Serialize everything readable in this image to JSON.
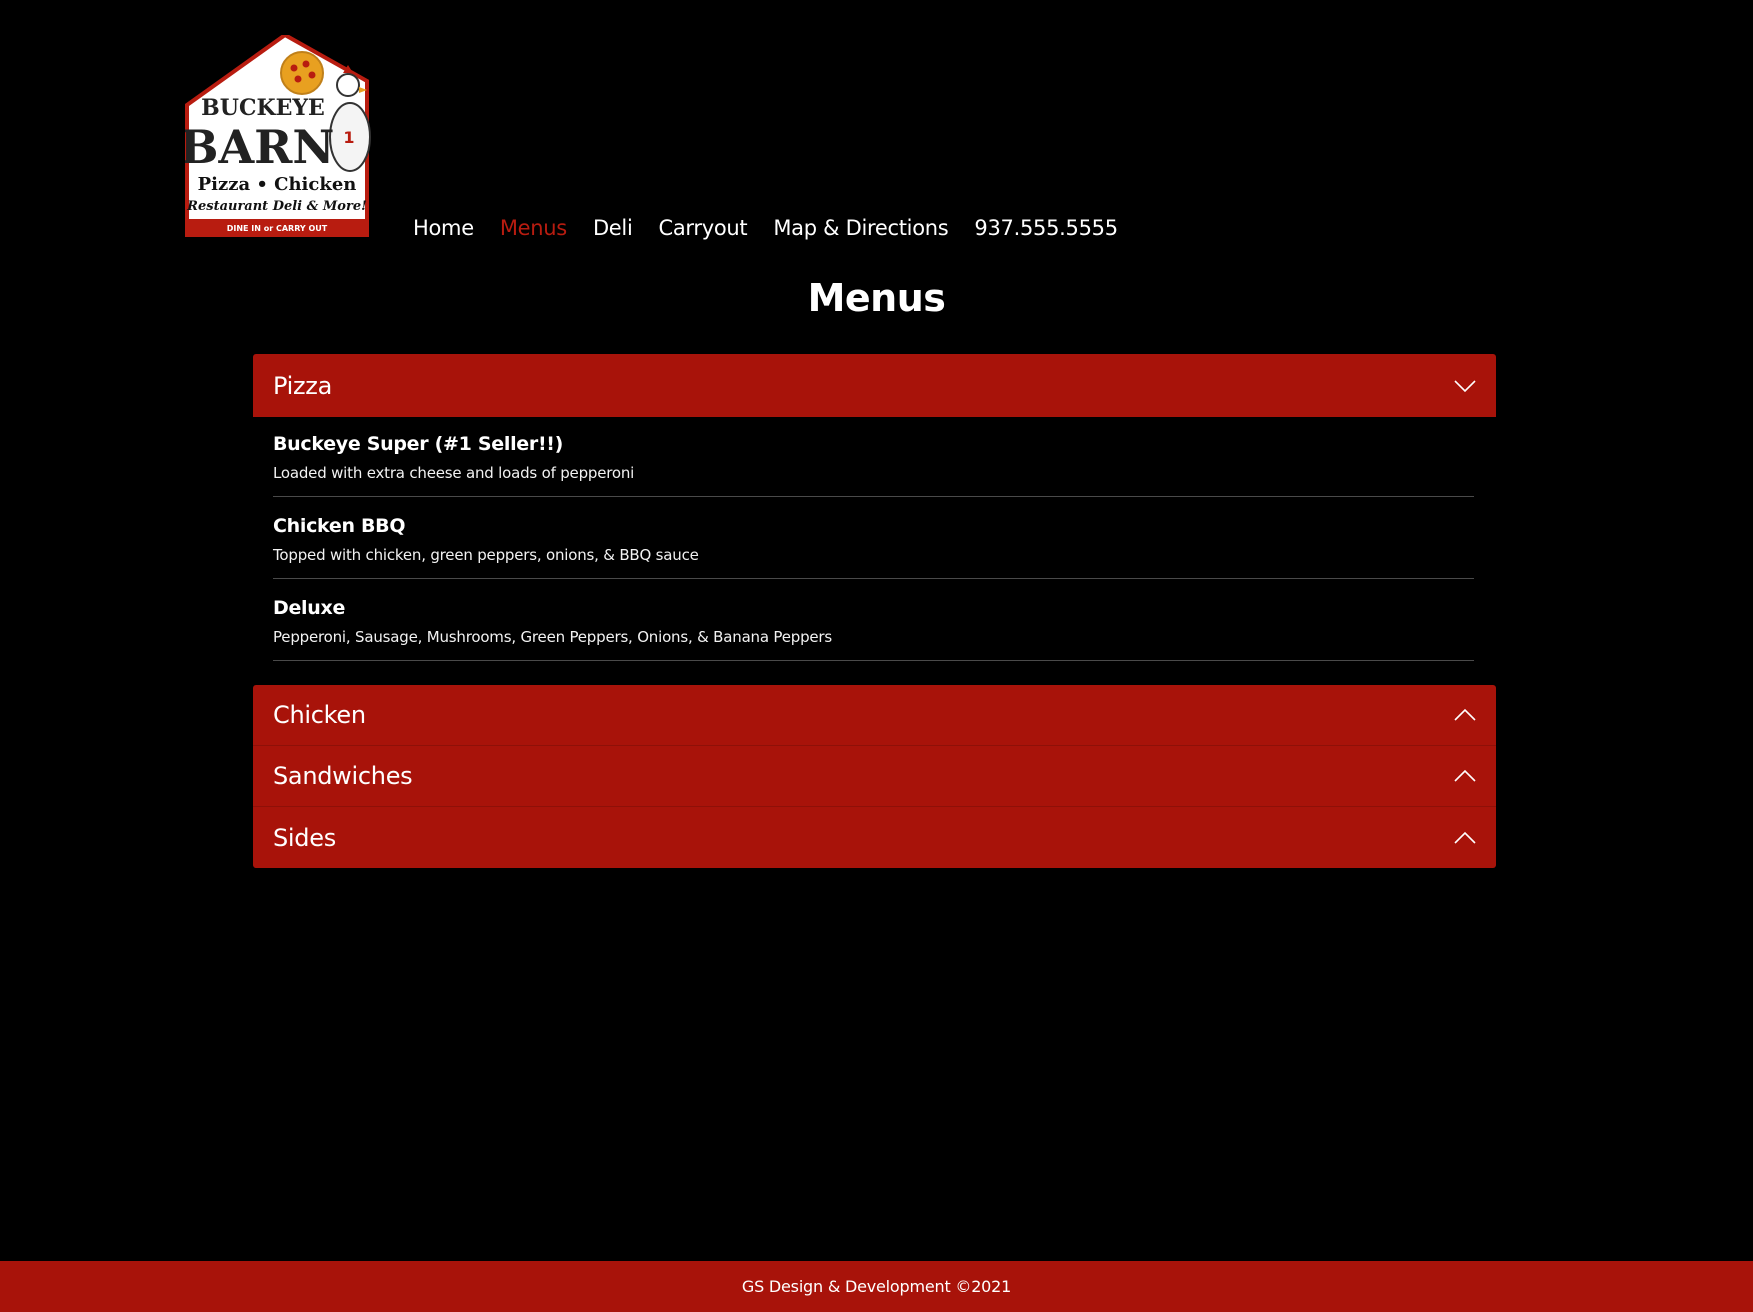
{
  "logo": {
    "line1": "BUCKEYE",
    "line2": "BARN",
    "line3": "Pizza • Chicken",
    "line4": "Restaurant Deli & More!",
    "line5": "DINE IN or CARRY OUT",
    "badge": "1"
  },
  "nav": {
    "items": [
      {
        "label": "Home",
        "active": false
      },
      {
        "label": "Menus",
        "active": true
      },
      {
        "label": "Deli",
        "active": false
      },
      {
        "label": "Carryout",
        "active": false
      },
      {
        "label": "Map & Directions",
        "active": false
      },
      {
        "label": "937.555.5555",
        "active": false
      }
    ]
  },
  "page": {
    "title": "Menus"
  },
  "menu": {
    "sections": [
      {
        "label": "Pizza",
        "expanded": true,
        "items": [
          {
            "name": "Buckeye Super (#1 Seller!!)",
            "description": "Loaded with extra cheese and loads of pepperoni"
          },
          {
            "name": "Chicken BBQ",
            "description": "Topped with chicken, green peppers, onions, & BBQ sauce"
          },
          {
            "name": "Deluxe",
            "description": "Pepperoni, Sausage, Mushrooms, Green Peppers, Onions, & Banana Peppers"
          }
        ]
      },
      {
        "label": "Chicken",
        "expanded": false
      },
      {
        "label": "Sandwiches",
        "expanded": false
      },
      {
        "label": "Sides",
        "expanded": false
      }
    ]
  },
  "footer": {
    "text": "GS Design & Development ©2021"
  },
  "colors": {
    "accent": "#a8130a",
    "active_link": "#b81c10",
    "background": "#000000"
  }
}
